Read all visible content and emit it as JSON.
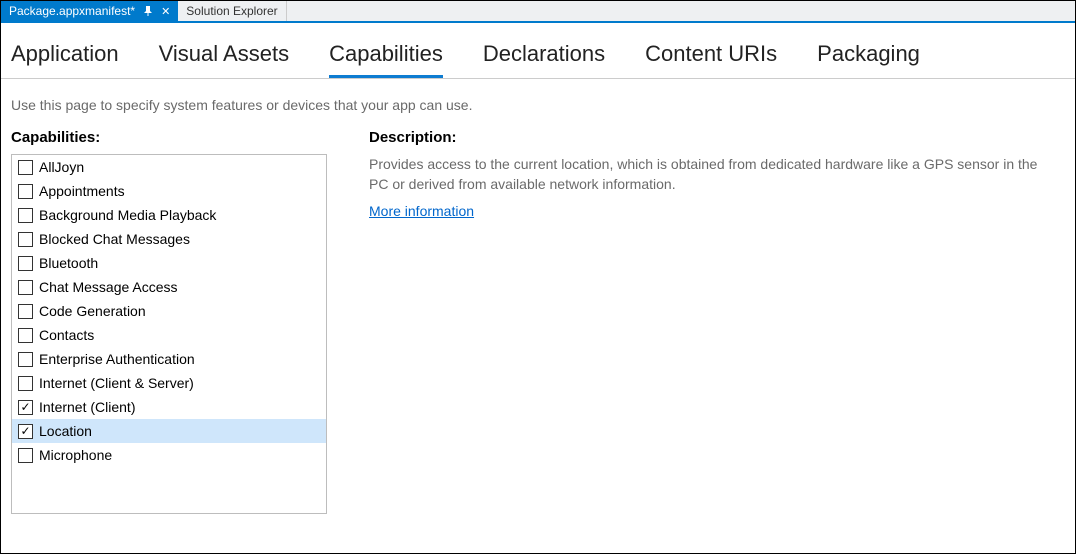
{
  "tabstrip": {
    "active_tab": "Package.appxmanifest*",
    "inactive_tab": "Solution Explorer"
  },
  "editor_tabs": [
    {
      "label": "Application",
      "active": false
    },
    {
      "label": "Visual Assets",
      "active": false
    },
    {
      "label": "Capabilities",
      "active": true
    },
    {
      "label": "Declarations",
      "active": false
    },
    {
      "label": "Content URIs",
      "active": false
    },
    {
      "label": "Packaging",
      "active": false
    }
  ],
  "help_text": "Use this page to specify system features or devices that your app can use.",
  "capabilities": {
    "heading": "Capabilities:",
    "items": [
      {
        "label": "AllJoyn",
        "checked": false,
        "selected": false
      },
      {
        "label": "Appointments",
        "checked": false,
        "selected": false
      },
      {
        "label": "Background Media Playback",
        "checked": false,
        "selected": false
      },
      {
        "label": "Blocked Chat Messages",
        "checked": false,
        "selected": false
      },
      {
        "label": "Bluetooth",
        "checked": false,
        "selected": false
      },
      {
        "label": "Chat Message Access",
        "checked": false,
        "selected": false
      },
      {
        "label": "Code Generation",
        "checked": false,
        "selected": false
      },
      {
        "label": "Contacts",
        "checked": false,
        "selected": false
      },
      {
        "label": "Enterprise Authentication",
        "checked": false,
        "selected": false
      },
      {
        "label": "Internet (Client & Server)",
        "checked": false,
        "selected": false
      },
      {
        "label": "Internet (Client)",
        "checked": true,
        "selected": false
      },
      {
        "label": "Location",
        "checked": true,
        "selected": true
      },
      {
        "label": "Microphone",
        "checked": false,
        "selected": false
      }
    ]
  },
  "description": {
    "heading": "Description:",
    "text": "Provides access to the current location, which is obtained from dedicated hardware like a GPS sensor in the PC or derived from available network information.",
    "link": "More information"
  }
}
